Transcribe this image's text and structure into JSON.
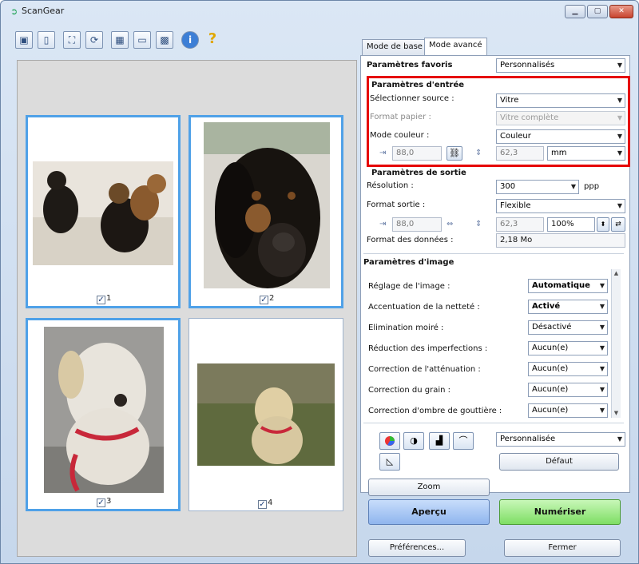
{
  "window": {
    "title": "ScanGear"
  },
  "toolbar": {
    "icons": [
      "scan-image-icon",
      "document-icon",
      "crop-frame-icon",
      "rotate-icon",
      "thumbnail-view-icon",
      "whole-image-icon",
      "multi-crop-icon",
      "info-icon",
      "help-icon"
    ]
  },
  "thumbnails": [
    {
      "label": "1",
      "checked": true,
      "selected": true
    },
    {
      "label": "2",
      "checked": true,
      "selected": true
    },
    {
      "label": "3",
      "checked": true,
      "selected": true
    },
    {
      "label": "4",
      "checked": true,
      "selected": false
    }
  ],
  "tabs": [
    {
      "label": "Mode de base",
      "active": false
    },
    {
      "label": "Mode avancé",
      "active": true
    }
  ],
  "favorites": {
    "label": "Paramètres favoris",
    "value": "Personnalisés"
  },
  "input": {
    "heading": "Paramètres d'entrée",
    "source_label": "Sélectionner source :",
    "source_value": "Vitre",
    "paper_label": "Format papier :",
    "paper_value": "Vitre complète",
    "color_label": "Mode couleur :",
    "color_value": "Couleur",
    "width": "88,0",
    "height": "62,3",
    "unit": "mm"
  },
  "output": {
    "heading": "Paramètres de sortie",
    "resolution_label": "Résolution :",
    "resolution_value": "300",
    "resolution_unit": "ppp",
    "size_label": "Format sortie :",
    "size_value": "Flexible",
    "width": "88,0",
    "height": "62,3",
    "scale": "100%",
    "datasize_label": "Format des données :",
    "datasize_value": "2,18 Mo"
  },
  "image": {
    "heading": "Paramètres d'image",
    "rows": [
      {
        "label": "Réglage de l'image :",
        "value": "Automatique",
        "bold": true
      },
      {
        "label": "Accentuation de la netteté :",
        "value": "Activé",
        "bold": true
      },
      {
        "label": "Elimination moiré :",
        "value": "Désactivé",
        "bold": false
      },
      {
        "label": "Réduction des imperfections :",
        "value": "Aucun(e)",
        "bold": false
      },
      {
        "label": "Correction de l'atténuation :",
        "value": "Aucun(e)",
        "bold": false
      },
      {
        "label": "Correction du grain :",
        "value": "Aucun(e)",
        "bold": false
      },
      {
        "label": "Correction d'ombre de gouttière :",
        "value": "Aucun(e)",
        "bold": false
      }
    ]
  },
  "adjust": {
    "tone_value": "Personnalisée",
    "default_label": "Défaut"
  },
  "buttons": {
    "zoom": "Zoom",
    "preview": "Aperçu",
    "scan": "Numériser",
    "preferences": "Préférences...",
    "close": "Fermer"
  },
  "colors": {
    "accent_blue": "#4fa1e8",
    "highlight_red": "#e60000",
    "preview_blue": "#8fb5ee",
    "scan_green": "#7ede64"
  }
}
